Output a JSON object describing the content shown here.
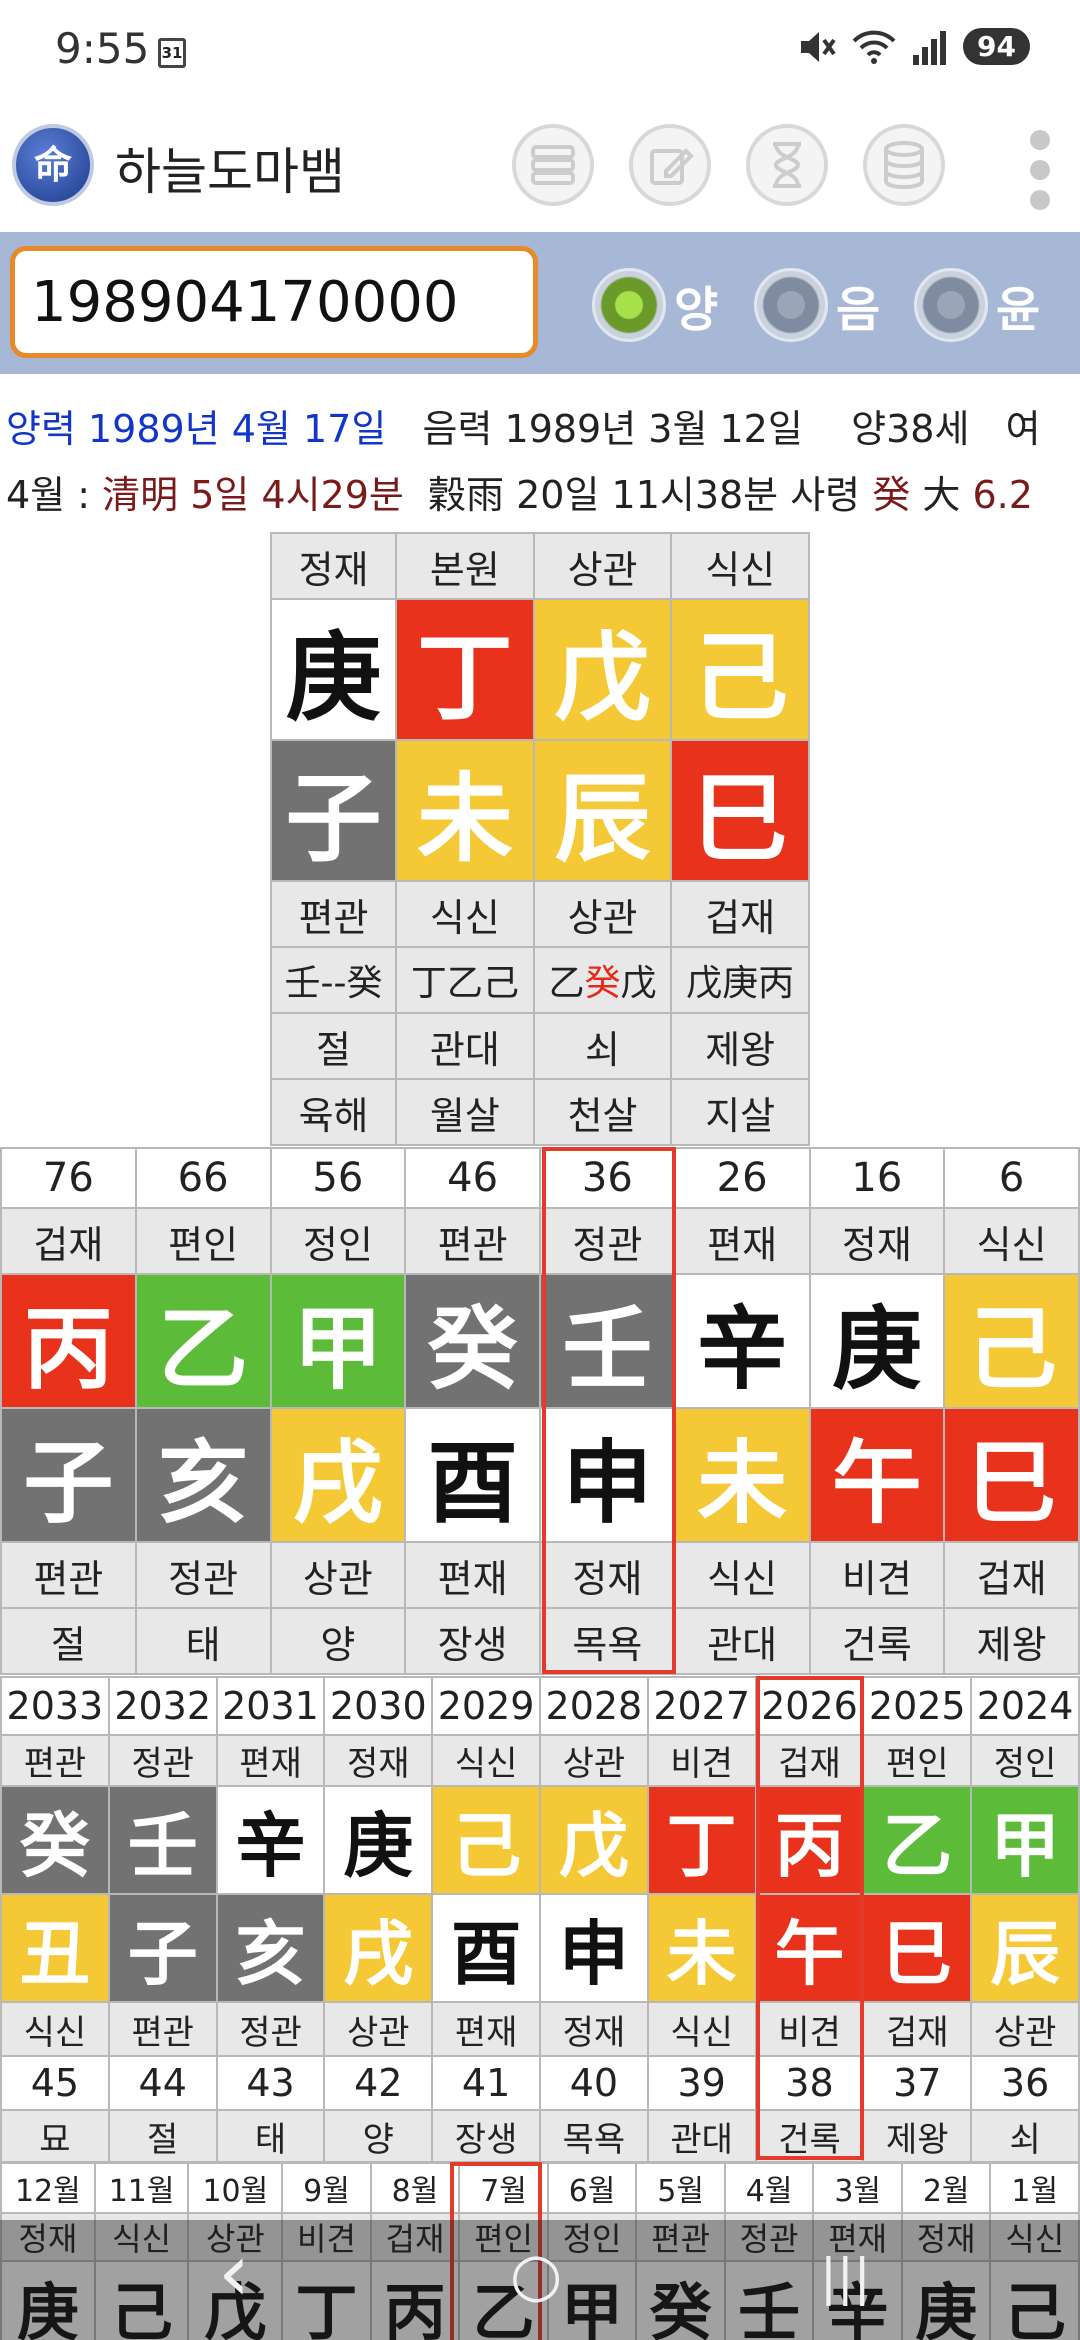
{
  "status": {
    "time": "9:55",
    "calendar_day": "31",
    "battery": "94"
  },
  "app": {
    "logo": "命",
    "title": "하늘도마뱀"
  },
  "toolbar": {
    "icons": [
      "list-icon",
      "edit-icon",
      "hourglass-icon",
      "database-icon",
      "more-icon"
    ]
  },
  "input": {
    "value": "198904170000"
  },
  "radios": [
    {
      "label": "양",
      "selected": true
    },
    {
      "label": "음",
      "selected": false
    },
    {
      "label": "윤",
      "selected": false
    }
  ],
  "info": {
    "solar": "양력 1989년 4월 17일",
    "lunar": "음력 1989년 3월 12일",
    "age": "양38세",
    "gender": "여",
    "month_label": "4월 :",
    "term1": "清明 5일 4시29분",
    "term2_a": "穀雨 20일 11시38분  사령",
    "term2_b": "癸",
    "term2_c": "大",
    "term2_d": "6.2"
  },
  "colors": {
    "red": "#e8321c",
    "yellow": "#f4c935",
    "gray": "#727272",
    "green": "#5cbc3a",
    "white": "#ffffff",
    "highlight": "#e33a2a"
  },
  "pillars": {
    "top_labels": [
      "정재",
      "본원",
      "상관",
      "식신"
    ],
    "stems": [
      {
        "c": "庚",
        "color": "white"
      },
      {
        "c": "丁",
        "color": "red"
      },
      {
        "c": "戊",
        "color": "yellow"
      },
      {
        "c": "己",
        "color": "yellow"
      }
    ],
    "branches": [
      {
        "c": "子",
        "color": "gray"
      },
      {
        "c": "未",
        "color": "yellow"
      },
      {
        "c": "辰",
        "color": "yellow"
      },
      {
        "c": "巳",
        "color": "red"
      }
    ],
    "bottom_labels": [
      "편관",
      "식신",
      "상관",
      "겁재"
    ],
    "hidden": [
      {
        "parts": [
          {
            "t": "壬--癸",
            "red": false
          }
        ]
      },
      {
        "parts": [
          {
            "t": "丁乙己",
            "red": false
          }
        ]
      },
      {
        "parts": [
          {
            "t": "乙",
            "red": false
          },
          {
            "t": "癸",
            "red": true
          },
          {
            "t": "戊",
            "red": false
          }
        ]
      },
      {
        "parts": [
          {
            "t": "戊庚丙",
            "red": false
          }
        ]
      }
    ],
    "stages": [
      "절",
      "관대",
      "쇠",
      "제왕"
    ],
    "spirits": [
      "육해",
      "월살",
      "천살",
      "지살"
    ]
  },
  "daeun": {
    "ages": [
      "76",
      "66",
      "56",
      "46",
      "36",
      "26",
      "16",
      "6"
    ],
    "top_labels": [
      "겁재",
      "편인",
      "정인",
      "편관",
      "정관",
      "편재",
      "정재",
      "식신"
    ],
    "stems": [
      {
        "c": "丙",
        "color": "red"
      },
      {
        "c": "乙",
        "color": "green"
      },
      {
        "c": "甲",
        "color": "green"
      },
      {
        "c": "癸",
        "color": "gray"
      },
      {
        "c": "壬",
        "color": "gray"
      },
      {
        "c": "辛",
        "color": "white"
      },
      {
        "c": "庚",
        "color": "white"
      },
      {
        "c": "己",
        "color": "yellow"
      }
    ],
    "branches": [
      {
        "c": "子",
        "color": "gray"
      },
      {
        "c": "亥",
        "color": "gray"
      },
      {
        "c": "戌",
        "color": "yellow"
      },
      {
        "c": "酉",
        "color": "white"
      },
      {
        "c": "申",
        "color": "white"
      },
      {
        "c": "未",
        "color": "yellow"
      },
      {
        "c": "午",
        "color": "red"
      },
      {
        "c": "巳",
        "color": "red"
      }
    ],
    "bottom_labels": [
      "편관",
      "정관",
      "상관",
      "편재",
      "정재",
      "식신",
      "비견",
      "겁재"
    ],
    "stages": [
      "절",
      "태",
      "양",
      "장생",
      "목욕",
      "관대",
      "건록",
      "제왕"
    ],
    "highlight_index": 4
  },
  "seun": {
    "years": [
      "2033",
      "2032",
      "2031",
      "2030",
      "2029",
      "2028",
      "2027",
      "2026",
      "2025",
      "2024"
    ],
    "top_labels": [
      "편관",
      "정관",
      "편재",
      "정재",
      "식신",
      "상관",
      "비견",
      "겁재",
      "편인",
      "정인"
    ],
    "stems": [
      {
        "c": "癸",
        "color": "gray"
      },
      {
        "c": "壬",
        "color": "gray"
      },
      {
        "c": "辛",
        "color": "white"
      },
      {
        "c": "庚",
        "color": "white"
      },
      {
        "c": "己",
        "color": "yellow"
      },
      {
        "c": "戊",
        "color": "yellow"
      },
      {
        "c": "丁",
        "color": "red"
      },
      {
        "c": "丙",
        "color": "red"
      },
      {
        "c": "乙",
        "color": "green"
      },
      {
        "c": "甲",
        "color": "green"
      }
    ],
    "branches": [
      {
        "c": "丑",
        "color": "yellow"
      },
      {
        "c": "子",
        "color": "gray"
      },
      {
        "c": "亥",
        "color": "gray"
      },
      {
        "c": "戌",
        "color": "yellow"
      },
      {
        "c": "酉",
        "color": "white"
      },
      {
        "c": "申",
        "color": "white"
      },
      {
        "c": "未",
        "color": "yellow"
      },
      {
        "c": "午",
        "color": "red"
      },
      {
        "c": "巳",
        "color": "red"
      },
      {
        "c": "辰",
        "color": "yellow"
      }
    ],
    "bottom_labels": [
      "식신",
      "편관",
      "정관",
      "상관",
      "편재",
      "정재",
      "식신",
      "비견",
      "겁재",
      "상관"
    ],
    "ages": [
      "45",
      "44",
      "43",
      "42",
      "41",
      "40",
      "39",
      "38",
      "37",
      "36"
    ],
    "stages": [
      "묘",
      "절",
      "태",
      "양",
      "장생",
      "목욕",
      "관대",
      "건록",
      "제왕",
      "쇠"
    ],
    "highlight_index": 7
  },
  "wolun": {
    "months": [
      "12월",
      "11월",
      "10월",
      "9월",
      "8월",
      "7월",
      "6월",
      "5월",
      "4월",
      "3월",
      "2월",
      "1월"
    ],
    "labels": [
      "정재",
      "식신",
      "상관",
      "비견",
      "겁재",
      "편인",
      "정인",
      "편관",
      "정관",
      "편재",
      "정재",
      "식신"
    ],
    "stems": [
      "庚",
      "己",
      "戊",
      "丁",
      "丙",
      "乙",
      "甲",
      "癸",
      "壬",
      "辛",
      "庚",
      "己"
    ],
    "highlight_index": 5
  },
  "nav": {
    "back": "‹",
    "home": "○",
    "recent": "|||"
  }
}
